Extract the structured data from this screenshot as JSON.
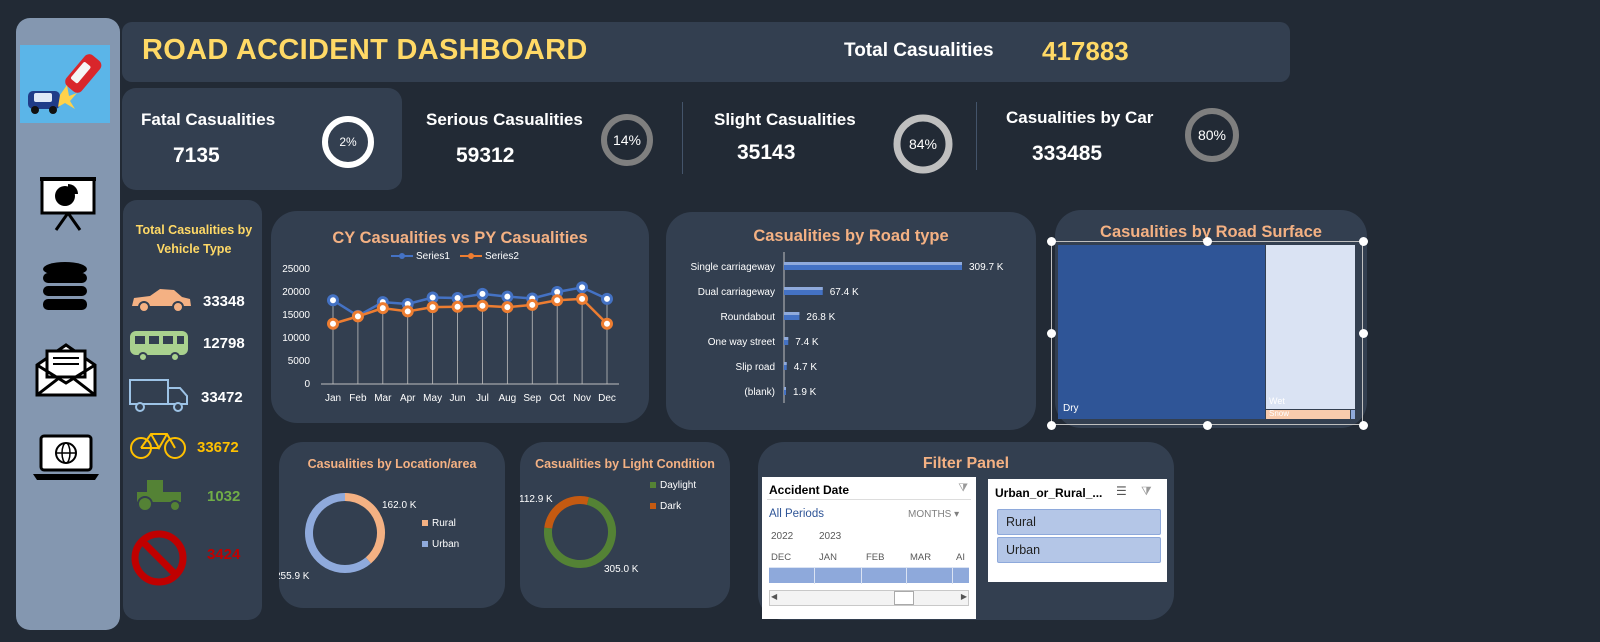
{
  "header": {
    "title": "ROAD ACCIDENT DASHBOARD",
    "total_label": "Total Casualities",
    "total_value": "417883"
  },
  "nav": {
    "icons": [
      "presentation-icon",
      "database-icon",
      "mail-icon",
      "laptop-globe-icon"
    ]
  },
  "kpis": [
    {
      "label": "Fatal Casualities",
      "value": "7135",
      "percent": "2%",
      "fraction": 0.02
    },
    {
      "label": "Serious Casualities",
      "value": "59312",
      "percent": "14%",
      "fraction": 0.14
    },
    {
      "label": "Slight Casualities",
      "value": "35143",
      "percent": "84%",
      "fraction": 0.84
    },
    {
      "label": "Casualities by Car",
      "value": "333485",
      "percent": "80%",
      "fraction": 0.8
    }
  ],
  "vehicle_panel": {
    "title": "Total Casualities by Vehicle Type",
    "items": [
      {
        "icon": "car-icon",
        "value": "33348",
        "color": "#f4b183"
      },
      {
        "icon": "bus-icon",
        "value": "12798",
        "color": "#a9d18e"
      },
      {
        "icon": "truck-icon",
        "value": "33472",
        "color": "#9dc3e6"
      },
      {
        "icon": "bicycle-icon",
        "value": "33672",
        "color": "#ffc000"
      },
      {
        "icon": "tractor-icon",
        "value": "1032",
        "color": "#70ad47"
      },
      {
        "icon": "no-entry-icon",
        "value": "3424",
        "color": "#c00000"
      }
    ]
  },
  "charts": {
    "cy_py": {
      "type": "line",
      "title": "CY Casualities vs PY Casualities",
      "categories": [
        "Jan",
        "Feb",
        "Mar",
        "Apr",
        "May",
        "Jun",
        "Jul",
        "Aug",
        "Sep",
        "Oct",
        "Nov",
        "Dec"
      ],
      "series": [
        {
          "name": "Series1",
          "color": "#4472c4",
          "values": [
            18200,
            14800,
            17800,
            17400,
            18800,
            18700,
            19600,
            19000,
            18600,
            20000,
            21000,
            18500
          ]
        },
        {
          "name": "Series2",
          "color": "#ed7d31",
          "values": [
            13100,
            14700,
            16500,
            15800,
            16700,
            16800,
            17000,
            16700,
            17200,
            18200,
            18500,
            13100
          ]
        }
      ],
      "ylim": [
        0,
        25000
      ],
      "yticks": [
        "25000",
        "20000",
        "15000",
        "10000",
        "5000",
        "0"
      ]
    },
    "road_type": {
      "type": "bar",
      "title": "Casualities by Road type",
      "categories": [
        "Single carriageway",
        "Dual carriageway",
        "Roundabout",
        "One way street",
        "Slip road",
        "(blank)"
      ],
      "values": [
        309.7,
        67.4,
        26.8,
        7.4,
        4.7,
        1.9
      ],
      "labels": [
        "309.7 K",
        "67.4 K",
        "26.8 K",
        "7.4 K",
        "4.7 K",
        "1.9 K"
      ]
    },
    "road_surface": {
      "type": "treemap",
      "title": "Casualities by Road Surface",
      "items": [
        {
          "label": "Dry",
          "color": "#2f5597"
        },
        {
          "label": "Wet",
          "color": "#dae3f3"
        },
        {
          "label": "Snow",
          "color": "#f8cbad"
        }
      ]
    },
    "location": {
      "type": "pie",
      "title": "Casualities by Location/area",
      "slices": [
        {
          "name": "Rural",
          "value": 162.0,
          "label": "162.0 K",
          "color": "#f4b183"
        },
        {
          "name": "Urban",
          "value": 255.9,
          "label": "255.9 K",
          "color": "#8faadc"
        }
      ]
    },
    "light": {
      "type": "pie",
      "title": "Casualities by Light Condition",
      "slices": [
        {
          "name": "Daylight",
          "value": 305.0,
          "label": "305.0 K",
          "color": "#548235"
        },
        {
          "name": "Dark",
          "value": 112.9,
          "label": "112.9 K",
          "color": "#c55a11"
        }
      ]
    }
  },
  "filter_panel": {
    "title": "Filter Panel",
    "date_slicer": {
      "header": "Accident Date",
      "selection": "All Periods",
      "level": "MONTHS",
      "years": [
        "2022",
        "2023"
      ],
      "months": [
        "DEC",
        "JAN",
        "FEB",
        "MAR",
        "AI"
      ]
    },
    "area_slicer": {
      "header": "Urban_or_Rural_...",
      "options": [
        "Rural",
        "Urban"
      ]
    }
  }
}
